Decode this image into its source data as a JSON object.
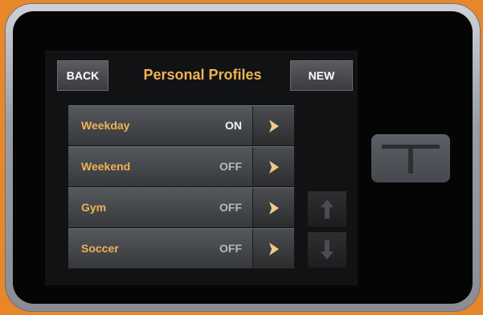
{
  "header": {
    "back_label": "BACK",
    "title": "Personal Profiles",
    "new_label": "NEW"
  },
  "profiles": [
    {
      "name": "Weekday",
      "state": "ON"
    },
    {
      "name": "Weekend",
      "state": "OFF"
    },
    {
      "name": "Gym",
      "state": "OFF"
    },
    {
      "name": "Soccer",
      "state": "OFF"
    }
  ],
  "icons": {
    "row_arrow": "chevron-right-icon",
    "scroll_up": "arrow-up-icon",
    "scroll_down": "arrow-down-icon",
    "home": "t-logo-icon"
  },
  "colors": {
    "accent": "#f0b354",
    "background": "#e8862a",
    "screen": "#111214"
  }
}
